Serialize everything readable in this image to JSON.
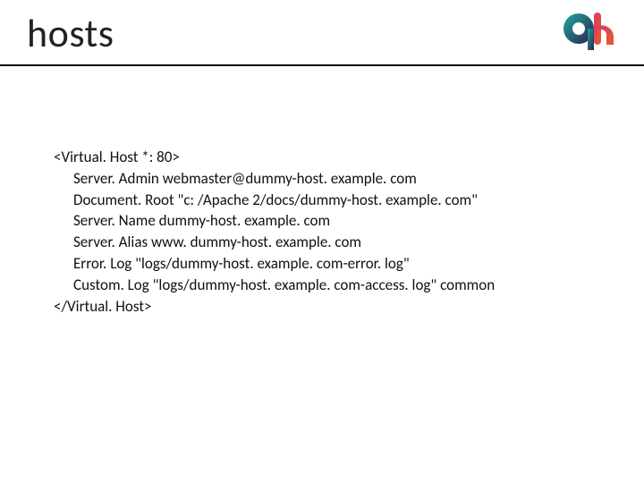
{
  "title": "hosts",
  "config": {
    "open": "<Virtual. Host *: 80>",
    "lines": [
      "Server. Admin webmaster@dummy-host. example. com",
      "Document. Root \"c: /Apache 2/docs/dummy-host. example. com\"",
      "Server. Name dummy-host. example. com",
      "Server. Alias www. dummy-host. example. com",
      "Error. Log \"logs/dummy-host. example. com-error. log\"",
      "Custom. Log \"logs/dummy-host. example. com-access. log\" common"
    ],
    "close": "</Virtual. Host>"
  },
  "logo": {
    "g_color1": "#1fa8a0",
    "g_color2": "#2d1f4b",
    "h_color1": "#d9396d",
    "h_color2": "#e85a2a"
  }
}
